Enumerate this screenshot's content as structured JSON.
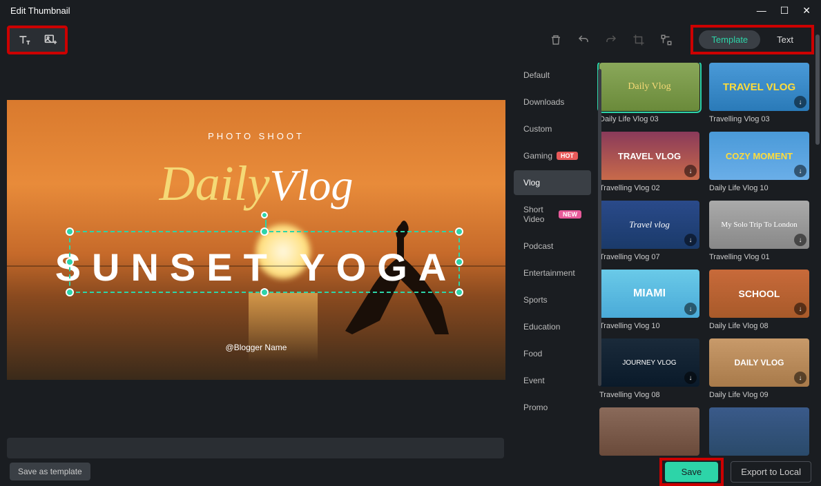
{
  "window": {
    "title": "Edit Thumbnail"
  },
  "tabs": {
    "template": "Template",
    "text": "Text"
  },
  "canvas": {
    "photo_shoot": "PHOTO SHOOT",
    "daily": "Daily",
    "vlog": "Vlog",
    "sunset_yoga": "SUNSET YOGA",
    "blogger": "@Blogger Name"
  },
  "categories": [
    {
      "label": "Default",
      "badge": null,
      "active": false
    },
    {
      "label": "Downloads",
      "badge": null,
      "active": false
    },
    {
      "label": "Custom",
      "badge": null,
      "active": false
    },
    {
      "label": "Gaming",
      "badge": "HOT",
      "active": false
    },
    {
      "label": "Vlog",
      "badge": null,
      "active": true
    },
    {
      "label": "Short Video",
      "badge": "NEW",
      "active": false
    },
    {
      "label": "Podcast",
      "badge": null,
      "active": false
    },
    {
      "label": "Entertainment",
      "badge": null,
      "active": false
    },
    {
      "label": "Sports",
      "badge": null,
      "active": false
    },
    {
      "label": "Education",
      "badge": null,
      "active": false
    },
    {
      "label": "Food",
      "badge": null,
      "active": false
    },
    {
      "label": "Event",
      "badge": null,
      "active": false
    },
    {
      "label": "Promo",
      "badge": null,
      "active": false
    }
  ],
  "templates": [
    {
      "label": "Daily Life Vlog 03",
      "thumb_text": "Daily Vlog",
      "selected": true,
      "thumb_class": "thumb-1"
    },
    {
      "label": "Travelling Vlog 03",
      "thumb_text": "TRAVEL VLOG",
      "selected": false,
      "thumb_class": "thumb-2"
    },
    {
      "label": "Travelling Vlog 02",
      "thumb_text": "TRAVEL VLOG",
      "selected": false,
      "thumb_class": "thumb-3"
    },
    {
      "label": "Daily Life Vlog 10",
      "thumb_text": "COZY MOMENT",
      "selected": false,
      "thumb_class": "thumb-4"
    },
    {
      "label": "Travelling Vlog 07",
      "thumb_text": "Travel vlog",
      "selected": false,
      "thumb_class": "thumb-5"
    },
    {
      "label": "Travelling Vlog 01",
      "thumb_text": "My Solo Trip To London",
      "selected": false,
      "thumb_class": "thumb-6"
    },
    {
      "label": "Travelling Vlog 10",
      "thumb_text": "MIAMI",
      "selected": false,
      "thumb_class": "thumb-7"
    },
    {
      "label": "Daily Life Vlog 08",
      "thumb_text": "SCHOOL",
      "selected": false,
      "thumb_class": "thumb-8"
    },
    {
      "label": "Travelling Vlog 08",
      "thumb_text": "JOURNEY VLOG",
      "selected": false,
      "thumb_class": "thumb-9"
    },
    {
      "label": "Daily Life Vlog 09",
      "thumb_text": "DAILY VLOG",
      "selected": false,
      "thumb_class": "thumb-10"
    },
    {
      "label": "",
      "thumb_text": "",
      "selected": false,
      "thumb_class": "thumb-11"
    },
    {
      "label": "",
      "thumb_text": "",
      "selected": false,
      "thumb_class": "thumb-12"
    }
  ],
  "footer": {
    "save_as_template": "Save as template",
    "save": "Save",
    "export": "Export to Local"
  },
  "colors": {
    "accent": "#2dd4a8",
    "highlight_box": "#c00"
  }
}
